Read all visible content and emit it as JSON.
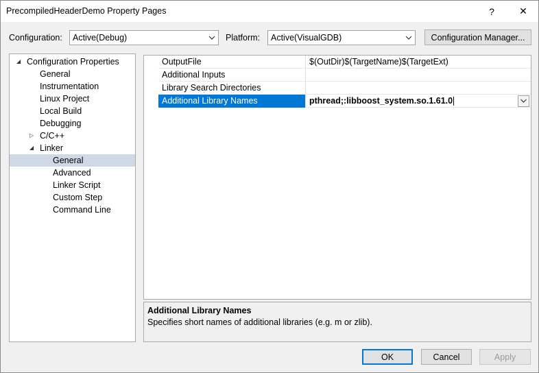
{
  "window": {
    "title": "PrecompiledHeaderDemo Property Pages",
    "help_label": "?",
    "close_label": "✕"
  },
  "config_bar": {
    "configuration_label": "Configuration:",
    "configuration_value": "Active(Debug)",
    "platform_label": "Platform:",
    "platform_value": "Active(VisualGDB)",
    "manager_button": "Configuration Manager..."
  },
  "tree": {
    "items": [
      {
        "label": "Configuration Properties",
        "expander": "◢"
      },
      {
        "label": "General"
      },
      {
        "label": "Instrumentation"
      },
      {
        "label": "Linux Project"
      },
      {
        "label": "Local Build"
      },
      {
        "label": "Debugging"
      },
      {
        "label": "C/C++",
        "expander": "▷"
      },
      {
        "label": "Linker",
        "expander": "◢"
      },
      {
        "label": "General"
      },
      {
        "label": "Advanced"
      },
      {
        "label": "Linker Script"
      },
      {
        "label": "Custom Step"
      },
      {
        "label": "Command Line"
      }
    ],
    "selected_index": 8
  },
  "properties": {
    "rows": [
      {
        "name": "OutputFile",
        "value": "$(OutDir)$(TargetName)$(TargetExt)"
      },
      {
        "name": "Additional Inputs",
        "value": ""
      },
      {
        "name": "Library Search Directories",
        "value": ""
      },
      {
        "name": "Additional Library Names",
        "value": "pthread;:libboost_system.so.1.61.0"
      }
    ],
    "selected_index": 3
  },
  "description": {
    "title": "Additional Library Names",
    "text": "Specifies short names of additional libraries (e.g. m or zlib)."
  },
  "buttons": {
    "ok": "OK",
    "cancel": "Cancel",
    "apply": "Apply"
  },
  "colors": {
    "selection_accent": "#0078d7",
    "tree_selection": "#d0d7e5"
  }
}
